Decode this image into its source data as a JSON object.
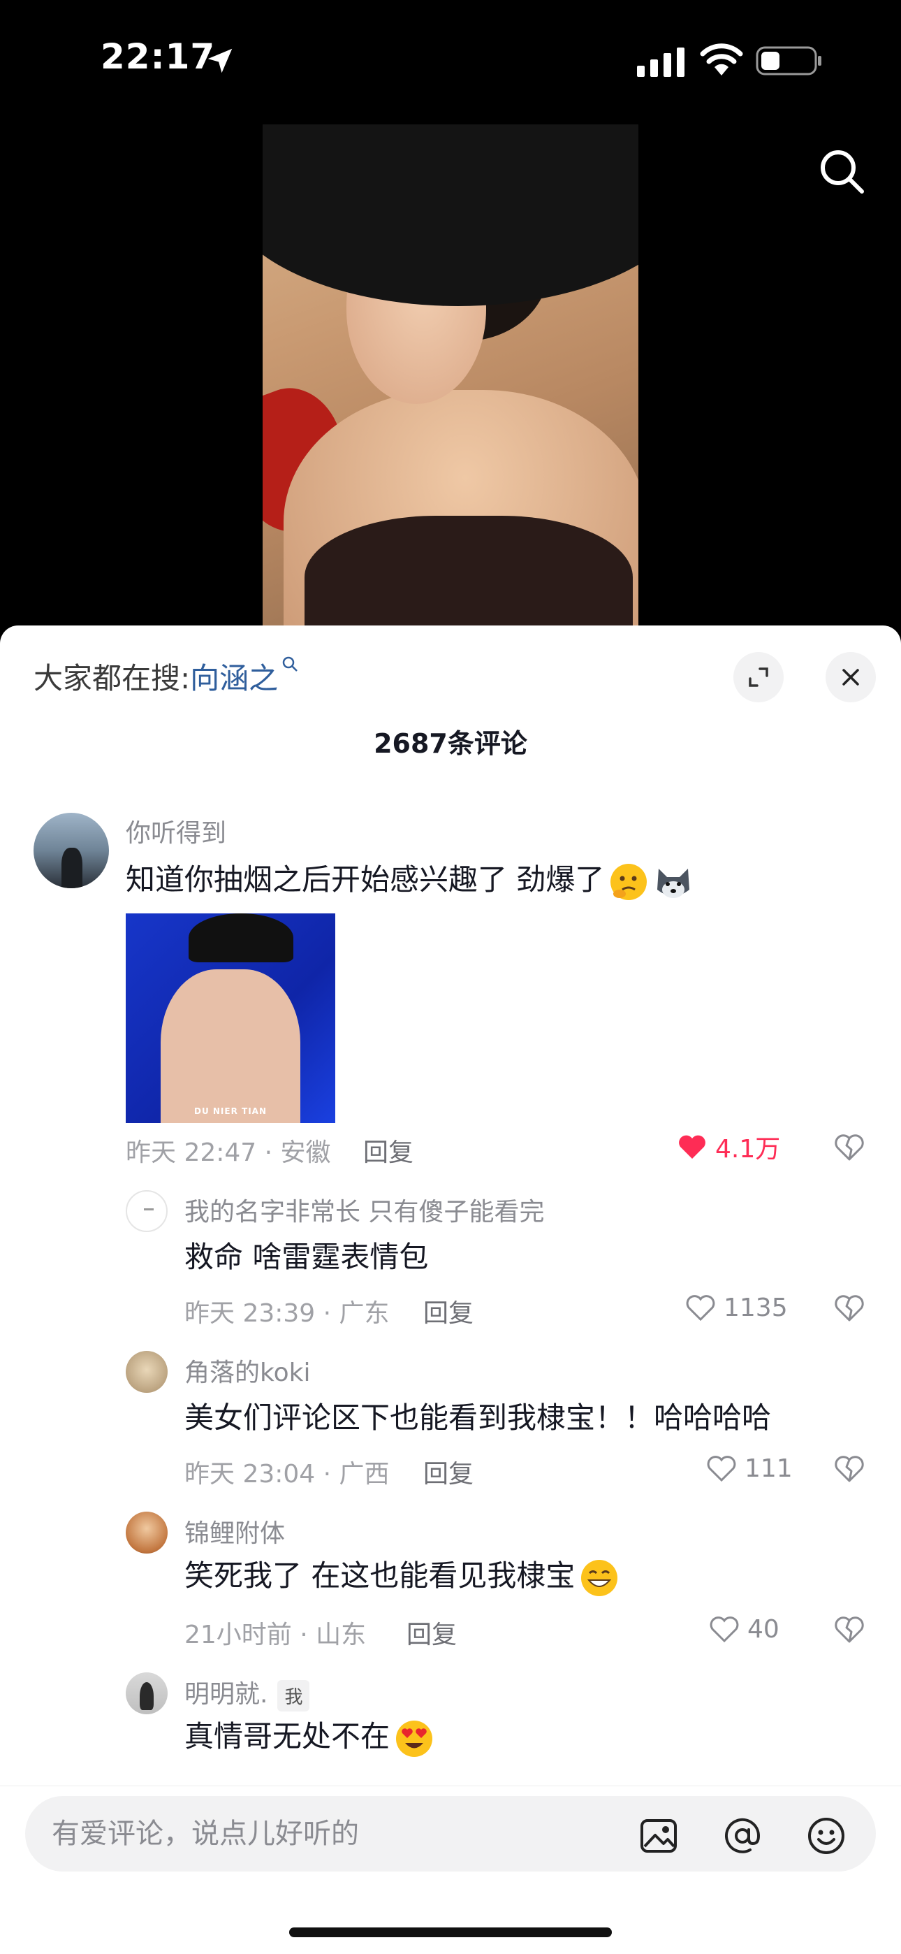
{
  "status_bar": {
    "time": "22:17"
  },
  "search_bar": {
    "label": "大家都在搜:",
    "term": "向涵之"
  },
  "comments_header": {
    "count_text": "2687条评论"
  },
  "comments": [
    {
      "username": "你听得到",
      "text": "知道你抽烟之后开始感兴趣了 劲爆了",
      "image_caption": "DU NIER TIAN",
      "meta": "昨天 22:47 · 安徽",
      "reply_label": "回复",
      "likes": "4.1万",
      "liked": true
    }
  ],
  "replies": [
    {
      "username": "我的名字非常长 只有傻子能看完",
      "text": "救命 啥雷霆表情包",
      "meta": "昨天 23:39 · 广东",
      "reply_label": "回复",
      "likes": "1135"
    },
    {
      "username": "角落的koki",
      "text": "美女们评论区下也能看到我棣宝！！哈哈哈哈",
      "meta": "昨天 23:04 · 广西",
      "reply_label": "回复",
      "likes": "111"
    },
    {
      "username": "锦鲤附体",
      "text": "笑死我了 在这也能看见我棣宝",
      "meta": "21小时前 · 山东",
      "reply_label": "回复",
      "likes": "40"
    },
    {
      "username": "明明就.",
      "tag": "我",
      "text": "真情哥无处不在"
    }
  ],
  "input": {
    "placeholder": "有爱评论，说点儿好听的"
  },
  "icons": {
    "status": [
      "location-arrow-icon",
      "signal-icon",
      "wifi-icon",
      "battery-icon"
    ],
    "actions": [
      "search-icon",
      "expand-icon",
      "close-icon",
      "heart-icon",
      "dislike-icon",
      "image-icon",
      "at-icon",
      "emoji-icon"
    ]
  },
  "colors": {
    "accent_like": "#fe2c55",
    "link": "#2f5e9c",
    "text": "#161823",
    "secondary": "#8a8b91"
  }
}
